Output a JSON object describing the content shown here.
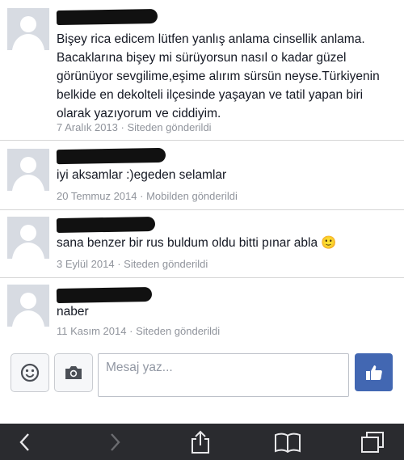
{
  "messages": [
    {
      "text": "Bişey rica edicem lütfen yanlış anlama cinsellik anlama. Bacaklarına bişey mi sürüyorsun nasıl o kadar güzel görünüyor sevgilime,eşime alırım sürsün neyse.Türkiyenin belkide en dekolteli ilçesinde yaşayan ve tatil yapan biri olarak yazıyorum ve ciddiyim.",
      "date": "7 Aralık 2013",
      "separator": "·",
      "source": "Siteden gönderildi"
    },
    {
      "text": "iyi aksamlar :)egeden selamlar",
      "date": "20 Temmuz 2014",
      "separator": "·",
      "source": "Mobilden gönderildi"
    },
    {
      "text": "sana benzer bir rus buldum oldu bitti pınar abla",
      "emoji": "🙂",
      "date": "3 Eylül 2014",
      "separator": "·",
      "source": "Siteden gönderildi"
    },
    {
      "text": "naber",
      "date": "11 Kasım 2014",
      "separator": "·",
      "source": "Siteden gönderildi"
    }
  ],
  "composer": {
    "placeholder": "Mesaj yaz...",
    "emoji_icon": "smiley-icon",
    "camera_icon": "camera-icon",
    "like_icon": "thumbs-up-icon"
  },
  "toolbar": {
    "icons": [
      "back-icon",
      "forward-icon",
      "share-icon",
      "bookmarks-icon",
      "tabs-icon"
    ]
  },
  "colors": {
    "accent": "#4267b2",
    "meta": "#90949c",
    "toolbar": "#2a2b2f"
  }
}
